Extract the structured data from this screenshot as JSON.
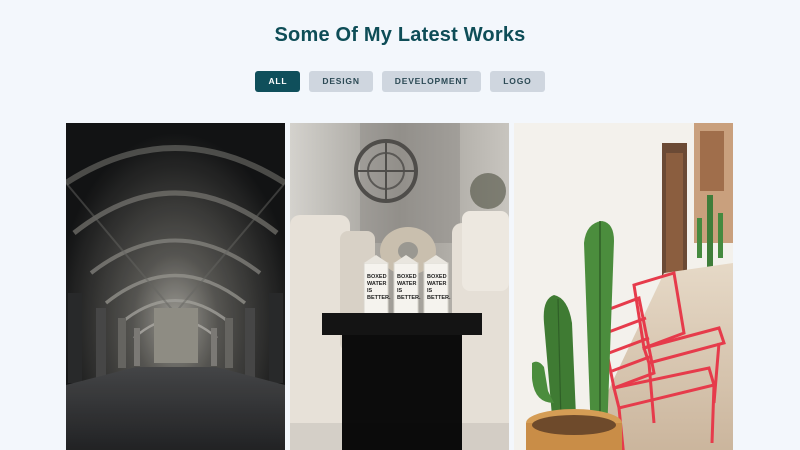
{
  "section": {
    "title": "Some Of My Latest Works"
  },
  "filters": [
    {
      "label": "ALL",
      "active": true
    },
    {
      "label": "DESIGN",
      "active": false
    },
    {
      "label": "DEVELOPMENT",
      "active": false
    },
    {
      "label": "LOGO",
      "active": false
    }
  ],
  "works": [
    {
      "subject": "vaulted-cloister-corridor"
    },
    {
      "subject": "boxed-water-cartons-on-table"
    },
    {
      "subject": "cactus-and-red-chairs"
    }
  ],
  "product_text": {
    "carton_line1": "BOXED",
    "carton_line2": "WATER",
    "carton_line3": "IS",
    "carton_line4": "BETTER."
  }
}
